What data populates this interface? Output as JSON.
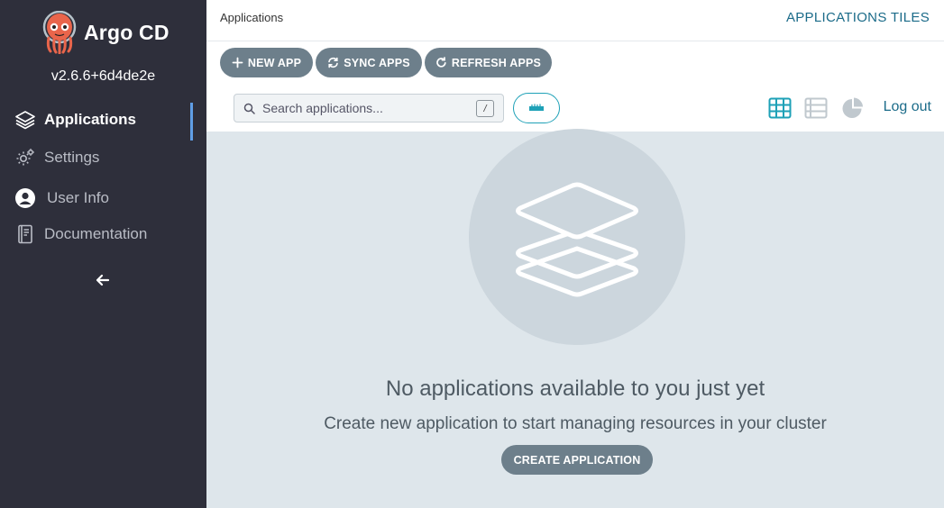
{
  "sidebar": {
    "brand": "Argo CD",
    "version": "v2.6.6+6d4de2e",
    "items": [
      {
        "label": "Applications",
        "icon": "layers-icon",
        "active": true
      },
      {
        "label": "Settings",
        "icon": "gears-icon",
        "active": false
      },
      {
        "label": "User Info",
        "icon": "user-circle-icon",
        "active": false
      },
      {
        "label": "Documentation",
        "icon": "book-icon",
        "active": false
      }
    ],
    "collapse_icon": "arrow-left-icon"
  },
  "header": {
    "breadcrumb": "Applications",
    "view_title": "APPLICATIONS TILES"
  },
  "toolbar": {
    "new_app": "NEW APP",
    "sync_apps": "SYNC APPS",
    "refresh_apps": "REFRESH APPS",
    "search_placeholder": "Search applications...",
    "search_shortcut": "/",
    "logout": "Log out"
  },
  "empty_state": {
    "title": "No applications available to you just yet",
    "subtitle": "Create new application to start managing resources in your cluster",
    "create_button": "CREATE APPLICATION"
  },
  "colors": {
    "sidebar_bg": "#2e2f3b",
    "accent_teal": "#1ea1b7",
    "link_teal": "#1b6b89",
    "button_gray": "#6d7f8b",
    "content_bg": "#dee6eb",
    "active_indicator": "#5f9ee6"
  }
}
